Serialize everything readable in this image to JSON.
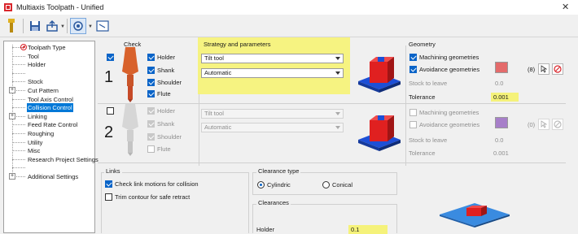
{
  "window": {
    "title": "Multiaxis Toolpath - Unified",
    "close_glyph": "✕"
  },
  "toolbar": {
    "items": [
      "tool-icon",
      "save-icon",
      "export-icon",
      "view-icon",
      "window-icon"
    ]
  },
  "tree": {
    "items": [
      {
        "label": "Toolpath Type",
        "selected": false,
        "expander": false,
        "icon": "prohibited-icon"
      },
      {
        "label": "Tool",
        "selected": false,
        "expander": false
      },
      {
        "label": "Holder",
        "selected": false,
        "expander": false
      },
      {
        "label": "",
        "selected": false,
        "expander": false
      },
      {
        "label": "Stock",
        "selected": false,
        "expander": false
      },
      {
        "label": "Cut Pattern",
        "selected": false,
        "expander": true
      },
      {
        "label": "Tool Axis Control",
        "selected": false,
        "expander": false
      },
      {
        "label": "Collision Control",
        "selected": true,
        "expander": false
      },
      {
        "label": "Linking",
        "selected": false,
        "expander": true
      },
      {
        "label": "Feed Rate Control",
        "selected": false,
        "expander": false
      },
      {
        "label": "Roughing",
        "selected": false,
        "expander": false
      },
      {
        "label": "Utility",
        "selected": false,
        "expander": false
      },
      {
        "label": "Misc",
        "selected": false,
        "expander": false
      },
      {
        "label": "Research Project Settings",
        "selected": false,
        "expander": false
      },
      {
        "label": "",
        "selected": false,
        "expander": false
      },
      {
        "label": "Additional Settings",
        "selected": false,
        "expander": true
      }
    ]
  },
  "headers": {
    "check": "Check",
    "strategy": "Strategy and parameters",
    "geometry": "Geometry"
  },
  "check_rows": [
    {
      "number": "1",
      "enabled": true,
      "parts": [
        {
          "label": "Holder",
          "checked": true
        },
        {
          "label": "Shank",
          "checked": true
        },
        {
          "label": "Shoulder",
          "checked": true
        },
        {
          "label": "Flute",
          "checked": true
        }
      ],
      "strategy": "Tilt tool",
      "mode": "Automatic",
      "machining_geometries": "Machining geometries",
      "machining_checked": true,
      "avoidance_geometries": "Avoidance geometries",
      "avoidance_checked": true,
      "avoidance_count": "(8)",
      "swatch_color": "#e46b6b",
      "stock_to_leave_label": "Stock to leave",
      "stock_to_leave": "0.0",
      "tolerance_label": "Tolerance",
      "tolerance": "0.001"
    },
    {
      "number": "2",
      "enabled": false,
      "parts": [
        {
          "label": "Holder",
          "checked": true
        },
        {
          "label": "Shank",
          "checked": true
        },
        {
          "label": "Shoulder",
          "checked": true
        },
        {
          "label": "Flute",
          "checked": false
        }
      ],
      "strategy": "Tilt tool",
      "mode": "Automatic",
      "machining_geometries": "Machining geometries",
      "machining_checked": false,
      "avoidance_geometries": "Avoidance geometries",
      "avoidance_checked": false,
      "avoidance_count": "(0)",
      "swatch_color": "#a77fc9",
      "stock_to_leave_label": "Stock to leave",
      "stock_to_leave": "0.0",
      "tolerance_label": "Tolerance",
      "tolerance": "0.001"
    }
  ],
  "links": {
    "title": "Links",
    "check_link_motions": "Check link motions for collision",
    "check_link_checked": true,
    "trim_contour": "Trim contour for safe retract",
    "trim_checked": false
  },
  "clearance_type": {
    "title": "Clearance type",
    "options": [
      {
        "label": "Cylindric",
        "selected": true
      },
      {
        "label": "Conical",
        "selected": false
      }
    ]
  },
  "clearances": {
    "title": "Clearances",
    "holder_label": "Holder",
    "holder_value": "0.1"
  },
  "colors": {
    "highlight": "#f5f27a",
    "selection": "#0078d7",
    "accent": "#0a64c8",
    "part_red": "#e02020",
    "part_blue": "#1d4fd6"
  }
}
